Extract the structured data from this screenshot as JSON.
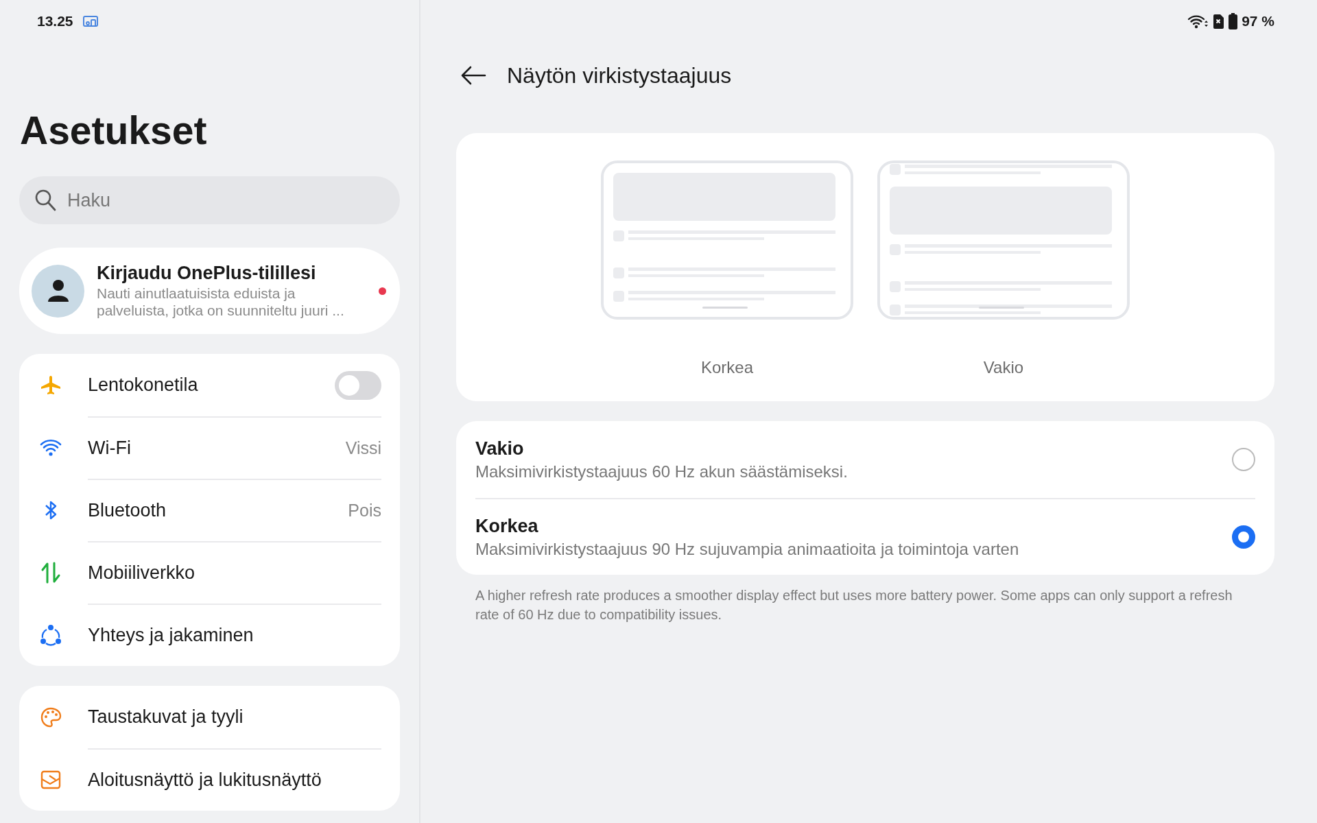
{
  "status_bar": {
    "time": "13.25",
    "battery": "97 %"
  },
  "sidebar": {
    "title": "Asetukset",
    "search": {
      "placeholder": "Haku"
    },
    "account": {
      "title": "Kirjaudu OnePlus-tilillesi",
      "subtitle": "Nauti ainutlaatuisista eduista ja palveluista, jotka on suunniteltu juuri ..."
    },
    "groups": [
      {
        "items": [
          {
            "kind": "toggle",
            "label": "Lentokonetila",
            "on": false
          },
          {
            "kind": "value",
            "label": "Wi-Fi",
            "value": "Vissi"
          },
          {
            "kind": "value",
            "label": "Bluetooth",
            "value": "Pois"
          },
          {
            "kind": "plain",
            "label": "Mobiiliverkko"
          },
          {
            "kind": "plain",
            "label": "Yhteys ja jakaminen"
          }
        ]
      },
      {
        "items": [
          {
            "kind": "plain",
            "label": "Taustakuvat ja tyyli"
          },
          {
            "kind": "plain",
            "label": "Aloitusnäyttö ja lukitusnäyttö"
          }
        ]
      }
    ]
  },
  "page": {
    "title": "Näytön virkistystaajuus",
    "previews": [
      {
        "label": "Korkea"
      },
      {
        "label": "Vakio"
      }
    ],
    "options": [
      {
        "title": "Vakio",
        "description": "Maksimivirkistystaajuus 60 Hz akun säästämiseksi.",
        "selected": false
      },
      {
        "title": "Korkea",
        "description": "Maksimivirkistystaajuus 90 Hz sujuvampia animaatioita ja toimintoja varten",
        "selected": true
      }
    ],
    "footnote": "A higher refresh rate produces a smoother display effect but uses more battery power. Some apps can only support a refresh rate of 60 Hz due to compatibility issues."
  }
}
